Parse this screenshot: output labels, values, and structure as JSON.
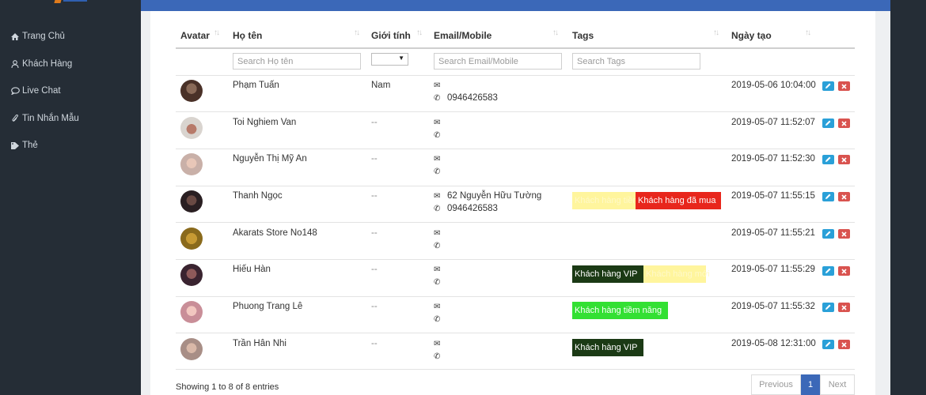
{
  "sidebar": {
    "items": [
      {
        "label": "Trang Chủ",
        "icon": "home-icon"
      },
      {
        "label": "Khách Hàng",
        "icon": "user-icon"
      },
      {
        "label": "Live Chat",
        "icon": "chat-bubble-icon"
      },
      {
        "label": "Tin Nhắn Mẫu",
        "icon": "paperclip-icon"
      },
      {
        "label": "Thẻ",
        "icon": "tags-icon"
      }
    ]
  },
  "table": {
    "columns": [
      "Avatar",
      "Họ tên",
      "Giới tính",
      "Email/Mobile",
      "Tags",
      "Ngày tạo"
    ],
    "filters": {
      "name_placeholder": "Search Họ tên",
      "email_placeholder": "Search Email/Mobile",
      "tags_placeholder": "Search Tags"
    },
    "rows": [
      {
        "name": "Phạm Tuấn",
        "gender": "Nam",
        "email": "",
        "phone": "0946426583",
        "tags": [],
        "created": "2019-05-06 10:04:00"
      },
      {
        "name": "Toi Nghiem Van",
        "gender": "--",
        "email": "",
        "phone": "",
        "tags": [],
        "created": "2019-05-07 11:52:07"
      },
      {
        "name": "Nguyễn Thị Mỹ An",
        "gender": "--",
        "email": "",
        "phone": "",
        "tags": [],
        "created": "2019-05-07 11:52:30"
      },
      {
        "name": "Thanh Ngọc",
        "gender": "--",
        "email": "62 Nguyễn Hữu Tường",
        "phone": "0946426583",
        "tags": [
          "Khách hàng tiềm năng",
          "Khách hàng đã mua"
        ],
        "created": "2019-05-07 11:55:15"
      },
      {
        "name": "Akarats Store No148",
        "gender": "--",
        "email": "",
        "phone": "",
        "tags": [],
        "created": "2019-05-07 11:55:21"
      },
      {
        "name": "Hiếu Hàn",
        "gender": "--",
        "email": "",
        "phone": "",
        "tags": [
          "Khách hàng VIP",
          "Khách hàng mới"
        ],
        "created": "2019-05-07 11:55:29"
      },
      {
        "name": "Phuong Trang Lê",
        "gender": "--",
        "email": "",
        "phone": "",
        "tags": [
          "Khách hàng tiềm năng"
        ],
        "created": "2019-05-07 11:55:32"
      },
      {
        "name": "Trần Hân Nhi",
        "gender": "--",
        "email": "",
        "phone": "",
        "tags": [
          "Khách hàng VIP"
        ],
        "created": "2019-05-08 12:31:00"
      }
    ]
  },
  "tag_colors": {
    "pale_yellow": "#fff59d",
    "red": "#e8261c",
    "dark_green": "#1b3a15",
    "bright_green": "#33e033"
  },
  "footer": {
    "info": "Showing 1 to 8 of 8 entries",
    "previous": "Previous",
    "current_page": "1",
    "next": "Next"
  },
  "colors": {
    "header_blue": "#3b68b8",
    "sidebar_bg": "#252d36"
  }
}
